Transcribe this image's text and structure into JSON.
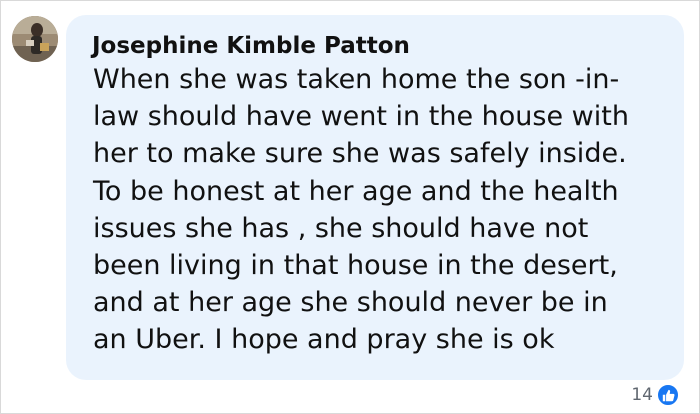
{
  "comment": {
    "author": "Josephine Kimble Patton",
    "text_lines": [
      "When she was taken home the son -in-",
      "law should have went in the house with",
      "her to make sure she was safely inside.",
      "To be honest at her age and the health",
      "issues she has , she should have not",
      "been living in that house in the desert,",
      "and at her age she should never be in",
      "an Uber. I hope and pray she is ok"
    ]
  },
  "reactions": {
    "count": "14",
    "icon": "thumbs-up-icon",
    "accent_color": "#1877f2"
  },
  "colors": {
    "bubble_bg": "#eaf3fd",
    "text": "#111111"
  }
}
